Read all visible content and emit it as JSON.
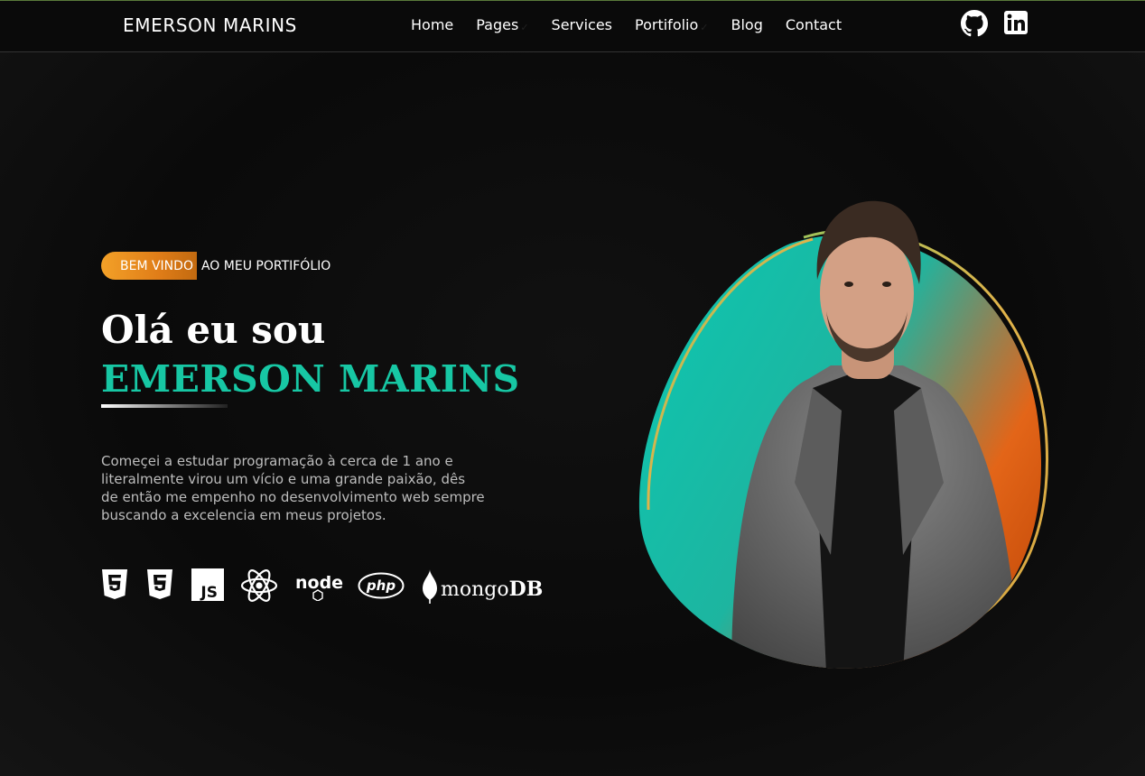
{
  "header": {
    "logo": "EMERSON MARINS",
    "nav": [
      {
        "label": "Home",
        "dropdown": false
      },
      {
        "label": "Pages",
        "dropdown": true
      },
      {
        "label": "Services",
        "dropdown": false
      },
      {
        "label": "Portifolio",
        "dropdown": true
      },
      {
        "label": "Blog",
        "dropdown": false
      },
      {
        "label": "Contact",
        "dropdown": false
      }
    ],
    "social_icons": [
      "github-icon",
      "linkedin-icon"
    ]
  },
  "hero": {
    "tag_highlight": "BEM VINDO",
    "tag_rest": "AO MEU PORTIFÓLIO",
    "greeting": "Olá eu sou",
    "name": "EMERSON MARINS",
    "bio": "Começei a estudar programação à cerca de 1 ano e literalmente virou um vício e uma grande paixão, dês de então me empenho no desenvolvimento web sempre buscando a excelencia em meus projetos.",
    "tech_icons": [
      "html5-icon",
      "css3-icon",
      "javascript-icon",
      "react-icon",
      "nodejs-icon",
      "php-icon",
      "mongodb-icon"
    ],
    "tech_labels": {
      "js": "JS",
      "node": "node",
      "php": "php",
      "mongo_a": "mongo",
      "mongo_b": "DB"
    }
  },
  "colors": {
    "accent_teal": "#17c7a4",
    "accent_orange": "#e07d18",
    "background": "#0b0b0b"
  }
}
